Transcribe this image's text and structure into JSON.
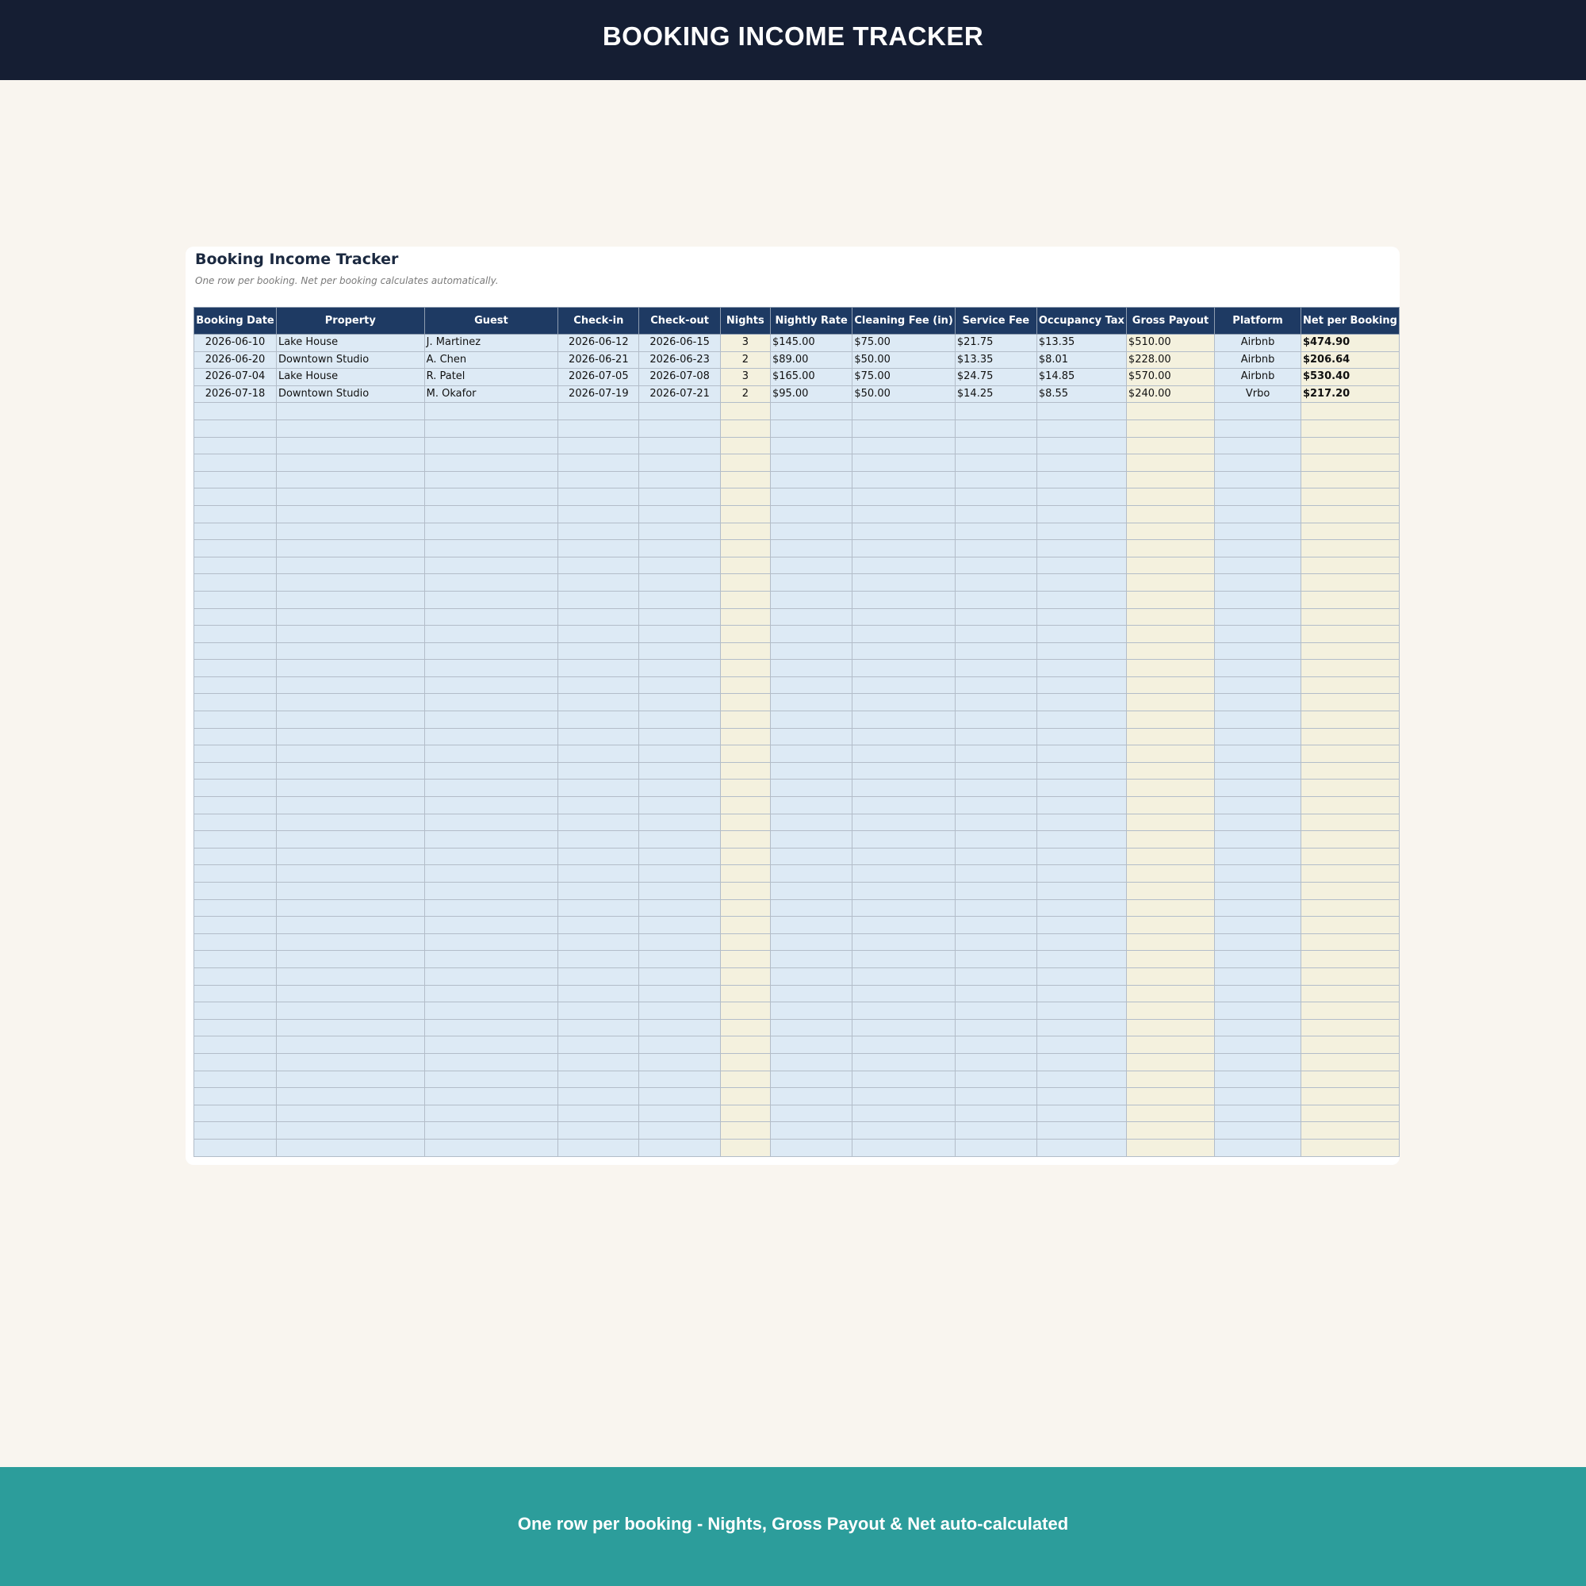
{
  "header": {
    "title": "BOOKING INCOME TRACKER"
  },
  "sheet": {
    "title": "Booking Income Tracker",
    "subtitle": "One row per booking. Net per booking calculates automatically."
  },
  "table": {
    "columns": [
      {
        "label": "Booking Date",
        "align": "center",
        "fill": "blue",
        "bold": false
      },
      {
        "label": "Property",
        "align": "left",
        "fill": "blue",
        "bold": false
      },
      {
        "label": "Guest",
        "align": "left",
        "fill": "blue",
        "bold": false
      },
      {
        "label": "Check-in",
        "align": "center",
        "fill": "blue",
        "bold": false
      },
      {
        "label": "Check-out",
        "align": "center",
        "fill": "blue",
        "bold": false
      },
      {
        "label": "Nights",
        "align": "center",
        "fill": "tan",
        "bold": false
      },
      {
        "label": "Nightly Rate",
        "align": "left",
        "fill": "blue",
        "bold": false
      },
      {
        "label": "Cleaning Fee (in)",
        "align": "left",
        "fill": "blue",
        "bold": false
      },
      {
        "label": "Service Fee",
        "align": "left",
        "fill": "blue",
        "bold": false
      },
      {
        "label": "Occupancy Tax",
        "align": "left",
        "fill": "blue",
        "bold": false
      },
      {
        "label": "Gross Payout",
        "align": "left",
        "fill": "tan",
        "bold": false
      },
      {
        "label": "Platform",
        "align": "center",
        "fill": "blue",
        "bold": false
      },
      {
        "label": "Net per Booking",
        "align": "left",
        "fill": "tan",
        "bold": true
      }
    ],
    "rows": [
      [
        "2026-06-10",
        "Lake House",
        "J. Martinez",
        "2026-06-12",
        "2026-06-15",
        "3",
        "$145.00",
        "$75.00",
        "$21.75",
        "$13.35",
        "$510.00",
        "Airbnb",
        "$474.90"
      ],
      [
        "2026-06-20",
        "Downtown Studio",
        "A. Chen",
        "2026-06-21",
        "2026-06-23",
        "2",
        "$89.00",
        "$50.00",
        "$13.35",
        "$8.01",
        "$228.00",
        "Airbnb",
        "$206.64"
      ],
      [
        "2026-07-04",
        "Lake House",
        "R. Patel",
        "2026-07-05",
        "2026-07-08",
        "3",
        "$165.00",
        "$75.00",
        "$24.75",
        "$14.85",
        "$570.00",
        "Airbnb",
        "$530.40"
      ],
      [
        "2026-07-18",
        "Downtown Studio",
        "M. Okafor",
        "2026-07-19",
        "2026-07-21",
        "2",
        "$95.00",
        "$50.00",
        "$14.25",
        "$8.55",
        "$240.00",
        "Vrbo",
        "$217.20"
      ]
    ],
    "empty_rows": 44
  },
  "footer": {
    "text": "One row per booking - Nights, Gross Payout & Net auto-calculated"
  },
  "colors": {
    "header_bg": "#151e33",
    "footer_bg": "#2c9d9b",
    "table_header_bg": "#1e3a63",
    "input_cell_bg": "#ddeaf5",
    "calc_cell_bg": "#f4f1de",
    "page_bg": "#f9f5ef"
  }
}
